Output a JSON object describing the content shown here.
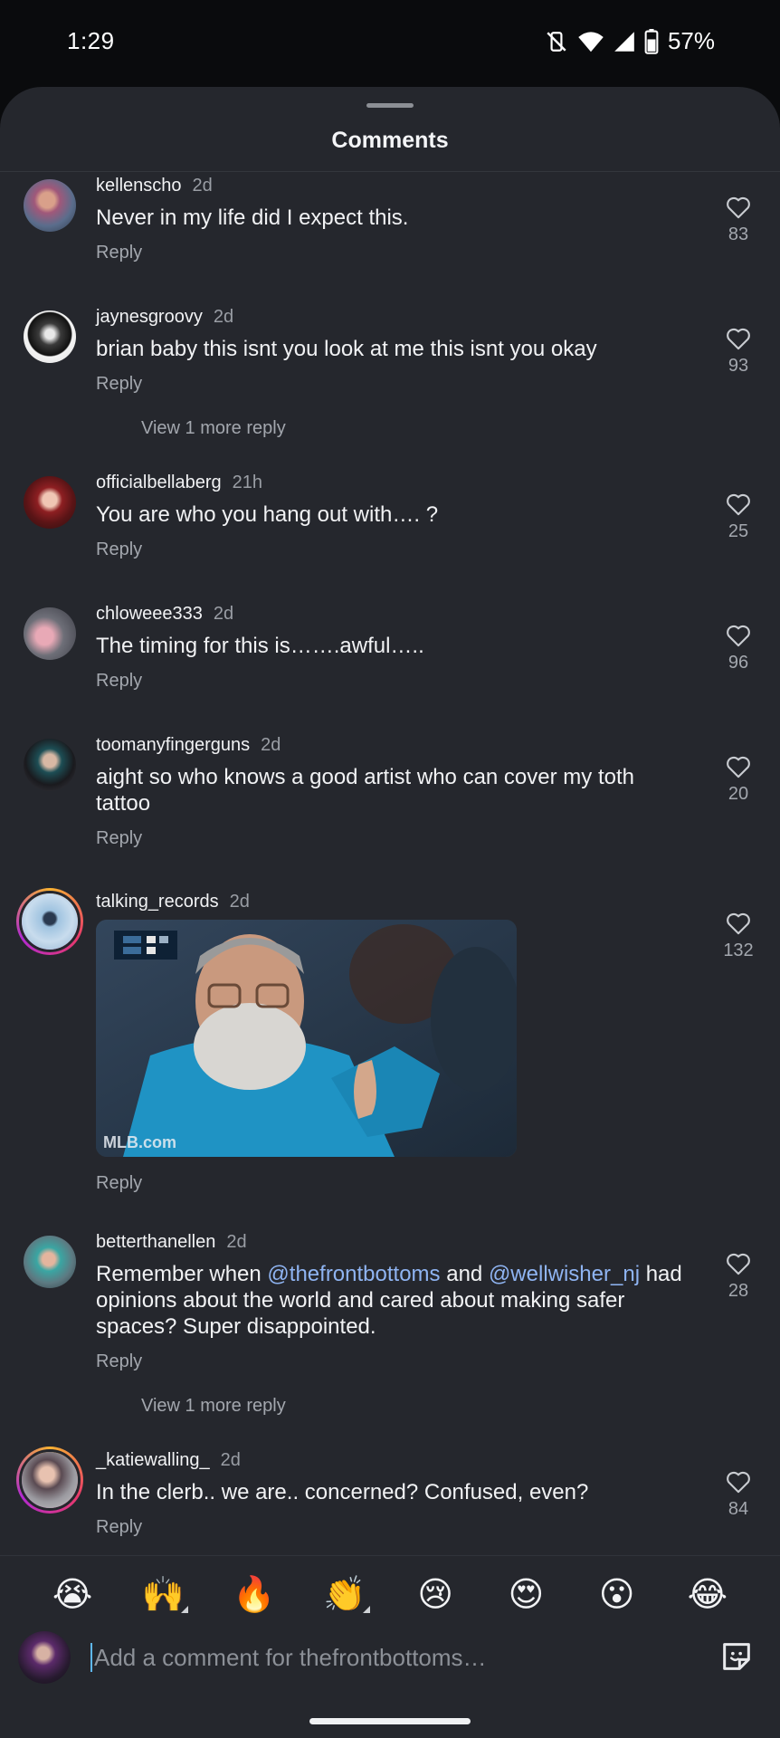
{
  "status_bar": {
    "time": "1:29",
    "battery_pct": "57%"
  },
  "sheet": {
    "title": "Comments"
  },
  "reply_label": "Reply",
  "view_more_label": "View 1 more reply",
  "comments": [
    {
      "username": "kellenscho",
      "time": "2d",
      "text": "Never in my life did I expect this.",
      "likes": "83"
    },
    {
      "username": "jaynesgroovy",
      "time": "2d",
      "text": "brian baby this isnt you look at me this isnt you okay",
      "likes": "93"
    },
    {
      "username": "officialbellaberg",
      "time": "21h",
      "text": "You are who you hang out with…. ?",
      "likes": "25"
    },
    {
      "username": "chloweee333",
      "time": "2d",
      "text": "The timing for this is…….awful…..",
      "likes": "96"
    },
    {
      "username": "toomanyfingerguns",
      "time": "2d",
      "text": "aight so who knows a good artist who can cover my toth tattoo",
      "likes": "20"
    },
    {
      "username": "talking_records",
      "time": "2d",
      "gif_watermark": "MLB.com",
      "likes": "132"
    },
    {
      "username": "betterthanellen",
      "time": "2d",
      "text_parts": [
        "Remember when ",
        "@thefrontbottoms",
        " and ",
        "@wellwisher_nj",
        " had opinions about the world and cared about making safer spaces? Super disappointed."
      ],
      "likes": "28"
    },
    {
      "username": "_katiewalling_",
      "time": "2d",
      "text": "In the clerb.. we are.. concerned? Confused, even?",
      "likes": "84"
    }
  ],
  "emoji_bar": [
    "😭",
    "🙌",
    "🔥",
    "👏",
    "😢",
    "😍",
    "😮",
    "😂"
  ],
  "input": {
    "placeholder": "Add a comment for thefrontbottoms…"
  },
  "colors": {
    "background": "#25272d",
    "mention": "#8fb4f2",
    "muted": "#a3a7ae"
  }
}
